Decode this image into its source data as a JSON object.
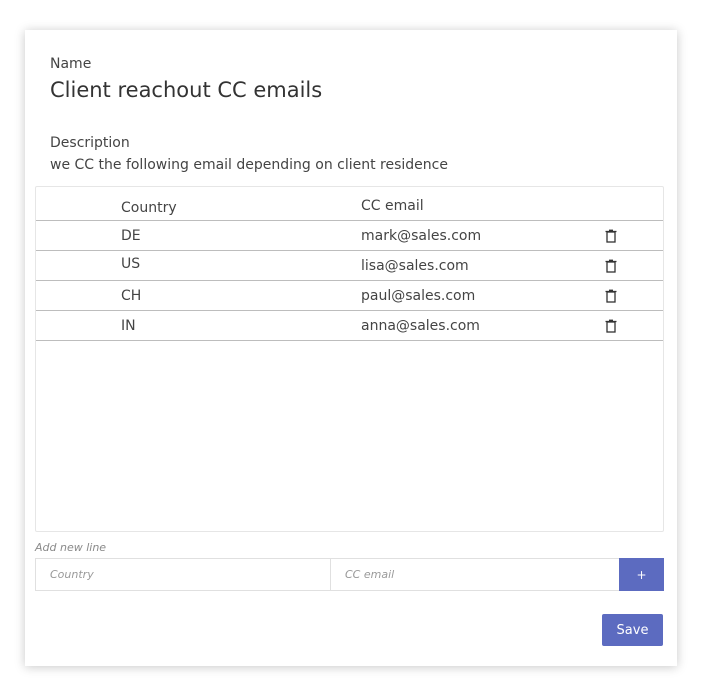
{
  "form": {
    "name_label": "Name",
    "name_value": "Client reachout CC emails",
    "description_label": "Description",
    "description_value": "we CC the following email depending on client residence"
  },
  "table": {
    "headers": {
      "country": "Country",
      "email": "CC email"
    },
    "rows": [
      {
        "country": "DE",
        "email": "mark@sales.com",
        "action_icon": "trash-icon"
      },
      {
        "country": "US",
        "email": "lisa@sales.com",
        "action_icon": "trash-icon"
      },
      {
        "country": "CH",
        "email": "paul@sales.com",
        "action_icon": "trash-icon"
      },
      {
        "country": "IN",
        "email": "anna@sales.com",
        "action_icon": "trash-icon"
      }
    ]
  },
  "add_line": {
    "label": "Add new line",
    "country_placeholder": "Country",
    "email_placeholder": "CC email",
    "country_value": "",
    "email_value": "",
    "add_button_label": "+"
  },
  "actions": {
    "save_label": "Save"
  },
  "colors": {
    "accent": "#5c6bc0",
    "divider": "#bdbdbd",
    "card_border": "#e6e6e6"
  }
}
